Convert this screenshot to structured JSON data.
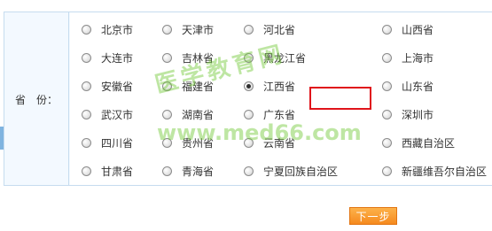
{
  "form": {
    "province_label": "省　份：",
    "selected_province": "江西省",
    "options": [
      {
        "label": "北京市",
        "checked": false
      },
      {
        "label": "天津市",
        "checked": false
      },
      {
        "label": "河北省",
        "checked": false
      },
      {
        "label": "山西省",
        "checked": false
      },
      {
        "label": "大连市",
        "checked": false
      },
      {
        "label": "吉林省",
        "checked": false
      },
      {
        "label": "黑龙江省",
        "checked": false
      },
      {
        "label": "上海市",
        "checked": false
      },
      {
        "label": "安徽省",
        "checked": false
      },
      {
        "label": "福建省",
        "checked": false
      },
      {
        "label": "江西省",
        "checked": true
      },
      {
        "label": "山东省",
        "checked": false
      },
      {
        "label": "武汉市",
        "checked": false
      },
      {
        "label": "湖南省",
        "checked": false
      },
      {
        "label": "广东省",
        "checked": false
      },
      {
        "label": "深圳市",
        "checked": false
      },
      {
        "label": "四川省",
        "checked": false
      },
      {
        "label": "贵州省",
        "checked": false
      },
      {
        "label": "云南省",
        "checked": false
      },
      {
        "label": "西藏自治区",
        "checked": false
      },
      {
        "label": "甘肃省",
        "checked": false
      },
      {
        "label": "青海省",
        "checked": false
      },
      {
        "label": "宁夏回族自治区",
        "checked": false
      },
      {
        "label": "新疆维吾尔自治区",
        "checked": false
      }
    ]
  },
  "buttons": {
    "next_label": "下一步"
  },
  "watermark": {
    "cn_text": "医学教育网",
    "url_text": "www.med66.com"
  },
  "colors": {
    "border": "#c6dcef",
    "label_bg": "#f3f9ff",
    "highlight": "#e0141b",
    "button": "#f58a1f",
    "watermark": "#6ec832"
  }
}
